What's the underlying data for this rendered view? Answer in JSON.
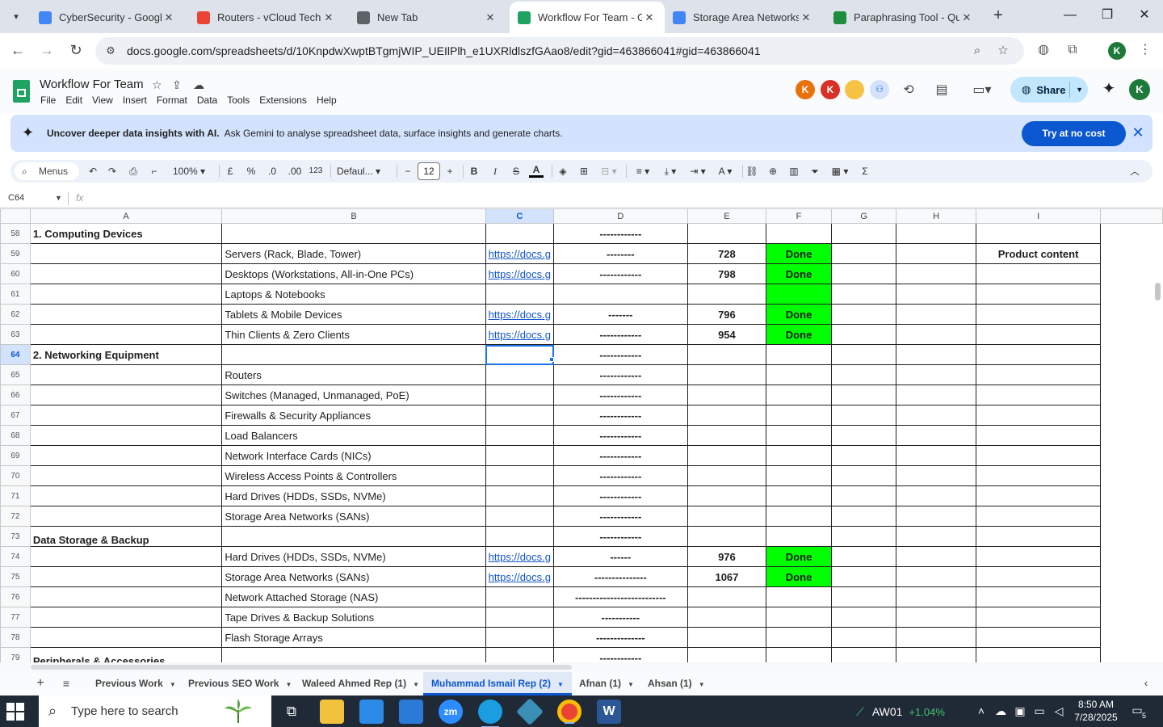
{
  "browser": {
    "tabs": [
      {
        "label": "CyberSecurity - Google",
        "color": "#4285f4",
        "active": false
      },
      {
        "label": "Routers - vCloud Tech",
        "color": "#ea4335",
        "active": false
      },
      {
        "label": "New Tab",
        "color": "#5f6368",
        "active": false
      },
      {
        "label": "Workflow For Team - Go",
        "color": "#1ea362",
        "active": true
      },
      {
        "label": "Storage Area Networks",
        "color": "#4285f4",
        "active": false
      },
      {
        "label": "Paraphrasing Tool - Qui",
        "color": "#1e8e3e",
        "active": false
      }
    ],
    "url": "docs.google.com/spreadsheets/d/10KnpdwXwptBTgmjWIP_UEIlPlh_e1UXRldlszfGAao8/edit?gid=463866041#gid=463866041",
    "profile_initial": "K"
  },
  "doc": {
    "title": "Workflow For Team",
    "menu": [
      "File",
      "Edit",
      "View",
      "Insert",
      "Format",
      "Data",
      "Tools",
      "Extensions",
      "Help"
    ],
    "collaborators": [
      {
        "initial": "K",
        "color": "#e8710a"
      },
      {
        "initial": "K",
        "color": "#d93025"
      }
    ],
    "share_label": "Share",
    "profile_initial": "K"
  },
  "banner": {
    "bold_text": "Uncover deeper data insights with AI.",
    "text": "Ask Gemini to analyse spreadsheet data, surface insights and generate charts.",
    "button": "Try at no cost"
  },
  "toolbar": {
    "menus_label": "Menus",
    "zoom": "100%",
    "currency": "£",
    "percent": "%",
    "dec_down": ".0",
    "dec_up": ".00",
    "number_format": "123",
    "font": "Defaul...",
    "font_size": "12"
  },
  "formula": {
    "cell_ref": "C64",
    "fx": "fx"
  },
  "grid": {
    "columns": [
      "A",
      "B",
      "C",
      "D",
      "E",
      "F",
      "G",
      "H",
      "I"
    ],
    "selected_column": "C",
    "selected_row": "64",
    "rows": [
      {
        "num": "58",
        "a": "1. Computing Devices",
        "a_type": "head",
        "b": "",
        "c": "",
        "d": "------------",
        "e": "",
        "f": "",
        "i": ""
      },
      {
        "num": "59",
        "a": "",
        "b": "Servers (Rack, Blade, Tower)",
        "c": "https://docs.g",
        "d": "--------",
        "e": "728",
        "f": "Done",
        "i": "Product content"
      },
      {
        "num": "60",
        "a": "",
        "b": "Desktops (Workstations, All-in-One PCs)",
        "c": "https://docs.g",
        "d": "------------",
        "e": "798",
        "f": "Done",
        "i": ""
      },
      {
        "num": "61",
        "a": "",
        "b": "Laptops & Notebooks",
        "c": "",
        "d": "",
        "e": "",
        "f": "",
        "f_green": true,
        "i": ""
      },
      {
        "num": "62",
        "a": "",
        "b": "Tablets & Mobile Devices",
        "c": "https://docs.g",
        "d": "-------",
        "e": "796",
        "f": "Done",
        "i": ""
      },
      {
        "num": "63",
        "a": "",
        "b": "Thin Clients & Zero Clients",
        "c": "https://docs.g",
        "d": "------------",
        "e": "954",
        "f": "Done",
        "i": ""
      },
      {
        "num": "64",
        "a": "2. Networking Equipment",
        "a_type": "head",
        "b": "",
        "c": "",
        "d": "------------",
        "e": "",
        "f": "",
        "i": ""
      },
      {
        "num": "65",
        "a": "",
        "b": "Routers",
        "c": "",
        "d": "------------",
        "e": "",
        "f": "",
        "i": ""
      },
      {
        "num": "66",
        "a": "",
        "b": "Switches (Managed, Unmanaged, PoE)",
        "c": "",
        "d": "------------",
        "e": "",
        "f": "",
        "i": ""
      },
      {
        "num": "67",
        "a": "",
        "b": "Firewalls & Security Appliances",
        "c": "",
        "d": "------------",
        "e": "",
        "f": "",
        "i": ""
      },
      {
        "num": "68",
        "a": "",
        "b": "Load Balancers",
        "c": "",
        "d": "------------",
        "e": "",
        "f": "",
        "i": ""
      },
      {
        "num": "69",
        "a": "",
        "b": "Network Interface Cards (NICs)",
        "c": "",
        "d": "------------",
        "e": "",
        "f": "",
        "i": ""
      },
      {
        "num": "70",
        "a": "",
        "b": "Wireless Access Points & Controllers",
        "c": "",
        "d": "------------",
        "e": "",
        "f": "",
        "i": ""
      },
      {
        "num": "71",
        "a": "",
        "b": "Hard Drives (HDDs, SSDs, NVMe)",
        "c": "",
        "d": "------------",
        "e": "",
        "f": "",
        "i": ""
      },
      {
        "num": "72",
        "a": "",
        "b": "Storage Area Networks (SANs)",
        "c": "",
        "d": "------------",
        "e": "",
        "f": "",
        "i": ""
      },
      {
        "num": "73",
        "a": "Data Storage & Backup",
        "a_type": "subhead",
        "b": "",
        "c": "",
        "d": "------------",
        "e": "",
        "f": "",
        "i": ""
      },
      {
        "num": "74",
        "a": "",
        "b": "Hard Drives (HDDs, SSDs, NVMe)",
        "c": "https://docs.g",
        "d": "------",
        "e": "976",
        "f": "Done",
        "i": ""
      },
      {
        "num": "75",
        "a": "",
        "b": "Storage Area Networks (SANs)",
        "c": "https://docs.g",
        "d": "---------------",
        "e": "1067",
        "f": "Done",
        "i": ""
      },
      {
        "num": "76",
        "a": "",
        "b": "Network Attached Storage (NAS)",
        "c": "",
        "d": "--------------------------",
        "e": "",
        "f": "",
        "i": ""
      },
      {
        "num": "77",
        "a": "",
        "b": "Tape Drives & Backup Solutions",
        "c": "",
        "d": "-----------",
        "e": "",
        "f": "",
        "i": ""
      },
      {
        "num": "78",
        "a": "",
        "b": "Flash Storage Arrays",
        "c": "",
        "d": "--------------",
        "e": "",
        "f": "",
        "i": ""
      },
      {
        "num": "79",
        "a": "Peripherals & Accessories",
        "a_type": "subhead",
        "b": "",
        "c": "",
        "d": "------------",
        "e": "",
        "f": "",
        "i": ""
      }
    ]
  },
  "sheet_tabs": [
    {
      "label": "Previous Work",
      "active": false
    },
    {
      "label": "Previous SEO Work",
      "active": false
    },
    {
      "label": "Waleed Ahmed Rep (1)",
      "active": false
    },
    {
      "label": "Muhammad Ismail Rep (2)",
      "active": true
    },
    {
      "label": "Afnan (1)",
      "active": false
    },
    {
      "label": "Ahsan (1)",
      "active": false
    }
  ],
  "taskbar": {
    "search_placeholder": "Type here to search",
    "stock_symbol": "AW01",
    "stock_change": "+1.04%",
    "time": "8:50 AM",
    "date": "7/28/2025",
    "notification_count": "5"
  }
}
